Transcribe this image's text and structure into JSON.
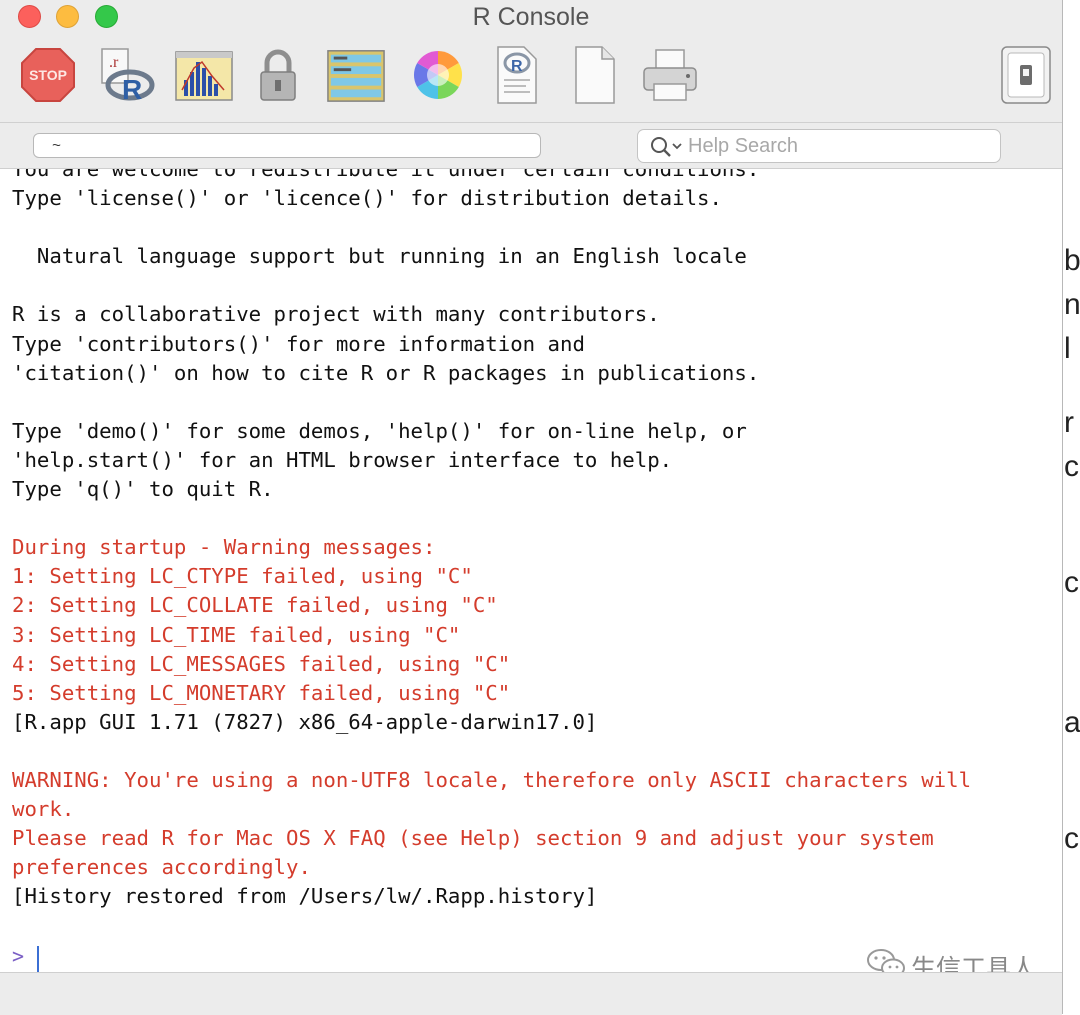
{
  "window": {
    "title": "R Console",
    "toolbar": [
      {
        "icon": "stop-icon",
        "label": "STOP"
      },
      {
        "icon": "source-script-icon",
        "label": ".r"
      },
      {
        "icon": "quartz-plot-icon"
      },
      {
        "icon": "lock-icon"
      },
      {
        "icon": "workspace-browser-icon"
      },
      {
        "icon": "color-wheel-icon"
      },
      {
        "icon": "r-document-icon"
      },
      {
        "icon": "new-document-icon"
      },
      {
        "icon": "print-icon"
      },
      {
        "icon": "toggle-sidebar-icon"
      }
    ]
  },
  "path_field": {
    "value": "~"
  },
  "help_search": {
    "placeholder": "Help Search"
  },
  "console": {
    "lines": [
      {
        "text": "You are welcome to redistribute it under certain conditions.",
        "color": "black"
      },
      {
        "text": "Type 'license()' or 'licence()' for distribution details.",
        "color": "black"
      },
      {
        "text": "",
        "color": "black"
      },
      {
        "text": "  Natural language support but running in an English locale",
        "color": "black"
      },
      {
        "text": "",
        "color": "black"
      },
      {
        "text": "R is a collaborative project with many contributors.",
        "color": "black"
      },
      {
        "text": "Type 'contributors()' for more information and",
        "color": "black"
      },
      {
        "text": "'citation()' on how to cite R or R packages in publications.",
        "color": "black"
      },
      {
        "text": "",
        "color": "black"
      },
      {
        "text": "Type 'demo()' for some demos, 'help()' for on-line help, or",
        "color": "black"
      },
      {
        "text": "'help.start()' for an HTML browser interface to help.",
        "color": "black"
      },
      {
        "text": "Type 'q()' to quit R.",
        "color": "black"
      },
      {
        "text": "",
        "color": "black"
      },
      {
        "text": "During startup - Warning messages:",
        "color": "red"
      },
      {
        "text": "1: Setting LC_CTYPE failed, using \"C\"",
        "color": "red"
      },
      {
        "text": "2: Setting LC_COLLATE failed, using \"C\"",
        "color": "red"
      },
      {
        "text": "3: Setting LC_TIME failed, using \"C\"",
        "color": "red"
      },
      {
        "text": "4: Setting LC_MESSAGES failed, using \"C\"",
        "color": "red"
      },
      {
        "text": "5: Setting LC_MONETARY failed, using \"C\"",
        "color": "red"
      },
      {
        "text": "[R.app GUI 1.71 (7827) x86_64-apple-darwin17.0]",
        "color": "black"
      },
      {
        "text": "",
        "color": "black"
      },
      {
        "text": "WARNING: You're using a non-UTF8 locale, therefore only ASCII characters will",
        "color": "red"
      },
      {
        "text": "work.",
        "color": "red"
      },
      {
        "text": "Please read R for Mac OS X FAQ (see Help) section 9 and adjust your system",
        "color": "red"
      },
      {
        "text": "preferences accordingly.",
        "color": "red"
      },
      {
        "text": "[History restored from /Users/lw/.Rapp.history]",
        "color": "black"
      }
    ],
    "prompt": ">"
  },
  "watermark": {
    "text": "生信工具人"
  },
  "background_window_chars": [
    "b",
    "n",
    "l",
    "r",
    "c",
    "c",
    "a",
    "c"
  ],
  "colors": {
    "warning_red": "#d43c2c",
    "prompt_purple": "#7b5fc5",
    "caret_blue": "#3b6fd4"
  }
}
